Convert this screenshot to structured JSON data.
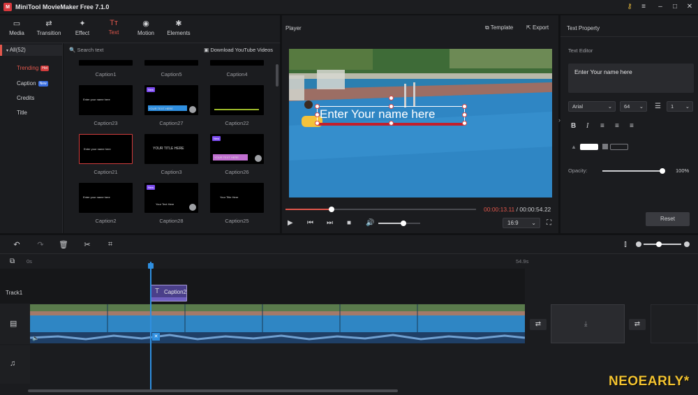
{
  "app": {
    "title": "MiniTool MovieMaker Free 7.1.0",
    "logo": "M"
  },
  "window_controls": [
    "key-icon",
    "menu-icon",
    "minimize-icon",
    "maximize-icon",
    "close-icon"
  ],
  "toolbar": {
    "items": [
      {
        "label": "Media",
        "icon": "▭"
      },
      {
        "label": "Transition",
        "icon": "⇄"
      },
      {
        "label": "Effect",
        "icon": "✦"
      },
      {
        "label": "Text",
        "icon": "Tт"
      },
      {
        "label": "Motion",
        "icon": "◉"
      },
      {
        "label": "Elements",
        "icon": "✱"
      }
    ],
    "active": "Text"
  },
  "leftnav": {
    "all": "All(52)",
    "items": [
      {
        "label": "Trending",
        "badge": "Hot"
      },
      {
        "label": "Caption",
        "badge": "New"
      },
      {
        "label": "Credits",
        "badge": ""
      },
      {
        "label": "Title",
        "badge": ""
      }
    ]
  },
  "library": {
    "search_placeholder": "Search text",
    "download_label": "Download YouTube Videos",
    "rows": [
      [
        "Caption1",
        "Caption5",
        "Caption4"
      ],
      [
        "Caption23",
        "Caption27",
        "Caption22"
      ],
      [
        "Caption21",
        "Caption3",
        "Caption26"
      ],
      [
        "Caption2",
        "Caption28",
        "Caption25"
      ]
    ],
    "thumb_texts": {
      "Caption23": "Enter your name here",
      "Caption27": "YOUR TEXT HERE",
      "Caption21": "Enter your name here",
      "Caption3": "YOUR TITLE HERE",
      "Caption26": "YOUR TEXT HERE",
      "Caption2": "Enter your name here",
      "Caption28": "Your Text Here",
      "Caption25": "Your Title Here"
    }
  },
  "player": {
    "title": "Player",
    "template_label": "Template",
    "export_label": "Export",
    "overlay_text": "Enter Your name here",
    "current_time": "00:00:13.11",
    "separator": " / ",
    "total_time": "00:00:54.22",
    "aspect": "16:9",
    "progress_fraction": 0.242,
    "volume_fraction": 0.6
  },
  "text_property": {
    "title": "Text Property",
    "editor_label": "Text Editor",
    "editor_value": "Enter Your name here",
    "font": "Arial",
    "size": "64",
    "line_spacing": "1",
    "opacity_label": "Opacity:",
    "opacity_value": "100%",
    "reset_label": "Reset"
  },
  "timeline": {
    "start_label": "0s",
    "end_label": "54.9s",
    "track1_label": "Track1",
    "clip_label": "Caption2"
  },
  "watermark": "NEOEARLY*"
}
